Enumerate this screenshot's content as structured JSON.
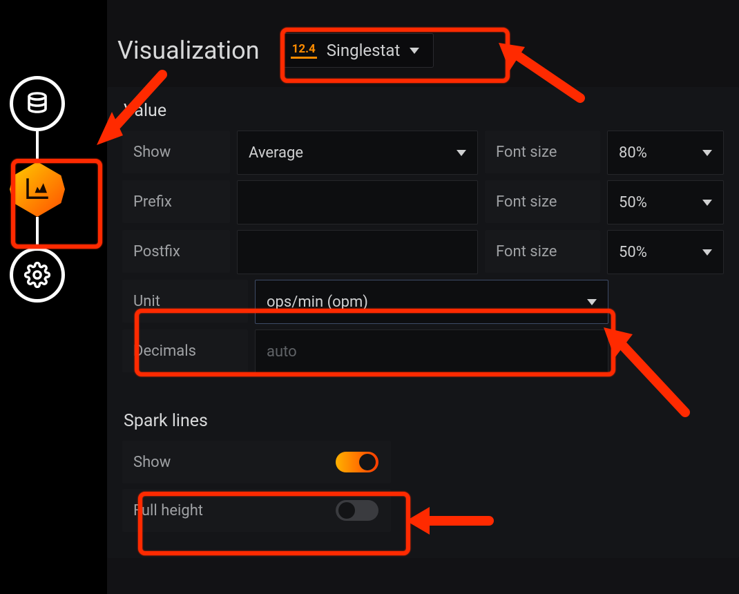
{
  "sidebar": {
    "items": [
      {
        "name": "queries",
        "icon": "database-icon"
      },
      {
        "name": "visualization",
        "icon": "chart-icon",
        "active": true
      },
      {
        "name": "settings",
        "icon": "gear-icon"
      }
    ]
  },
  "header": {
    "title": "Visualization",
    "picker_badge": "12.4",
    "picker_label": "Singlestat"
  },
  "value_section": {
    "title": "Value",
    "rows": {
      "show": {
        "label": "Show",
        "value": "Average",
        "font_label": "Font size",
        "font_value": "80%"
      },
      "prefix": {
        "label": "Prefix",
        "value": "",
        "font_label": "Font size",
        "font_value": "50%"
      },
      "postfix": {
        "label": "Postfix",
        "value": "",
        "font_label": "Font size",
        "font_value": "50%"
      },
      "unit": {
        "label": "Unit",
        "value": "ops/min (opm)"
      },
      "decimals": {
        "label": "Decimals",
        "placeholder": "auto"
      }
    }
  },
  "spark_section": {
    "title": "Spark lines",
    "show": {
      "label": "Show",
      "on": true
    },
    "full_height": {
      "label": "Full height",
      "on": false
    }
  }
}
